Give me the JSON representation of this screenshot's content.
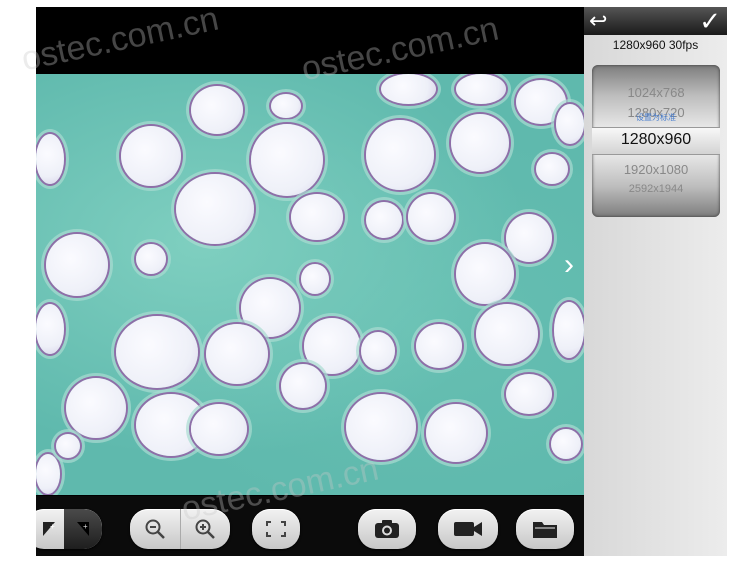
{
  "viewer": {
    "next_arrow": "›"
  },
  "toolbar": {
    "buttons": [
      {
        "name": "overlay-left-button",
        "icon": "overlay-icon"
      },
      {
        "name": "overlay-right-button",
        "icon": "overlay-icon"
      },
      {
        "name": "zoom-out-button",
        "icon": "zoom-out-icon"
      },
      {
        "name": "zoom-in-button",
        "icon": "zoom-in-icon"
      },
      {
        "name": "fullscreen-button",
        "icon": "fullscreen-icon"
      },
      {
        "name": "camera-button",
        "icon": "camera-icon"
      },
      {
        "name": "video-button",
        "icon": "video-camera-icon"
      },
      {
        "name": "folder-button",
        "icon": "folder-icon"
      }
    ]
  },
  "panel": {
    "back_icon": "↩",
    "confirm_icon": "✓",
    "current_resolution": "1280x960 30fps",
    "resolution_sublabel": "设置为标准",
    "options": [
      "1024x768",
      "1280x720",
      "1280x960",
      "1920x1080",
      "2592x1944"
    ],
    "selected_index": 2
  },
  "watermark": "ostec.com.cn"
}
